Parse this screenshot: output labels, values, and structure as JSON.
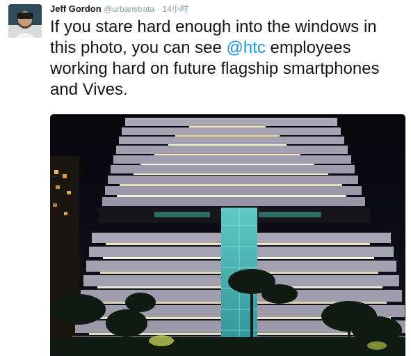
{
  "tweet": {
    "author_name": "Jeff Gordon",
    "handle": "@urbanstrata",
    "separator": "·",
    "timestamp": "14小时",
    "text_before": "If you stare hard enough into the windows in this photo, you can see ",
    "mention": "@htc",
    "text_after": " employees working hard on future flagship smartphones and Vives."
  },
  "colors": {
    "mention": "#1b95e0",
    "name": "#14171a",
    "meta": "#8899a6"
  }
}
